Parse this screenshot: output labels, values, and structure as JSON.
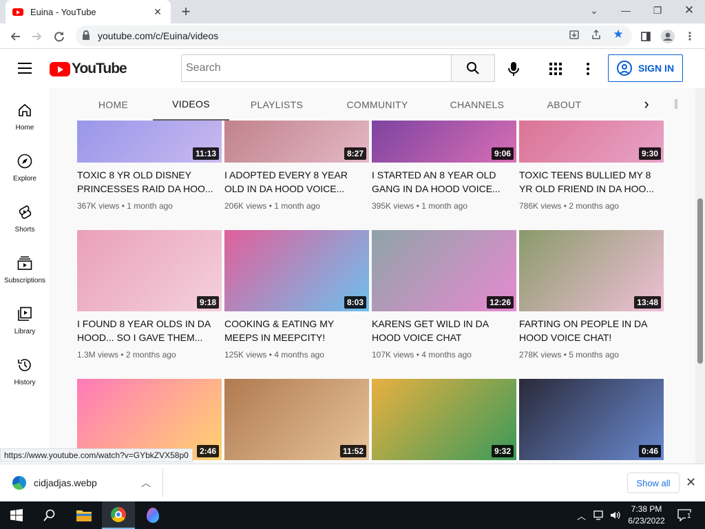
{
  "browser": {
    "tab_title": "Euina - YouTube",
    "url": "youtube.com/c/Euina/videos",
    "status_url": "https://www.youtube.com/watch?v=GYbkZVX58p0"
  },
  "header": {
    "logo_text": "YouTube",
    "search_placeholder": "Search",
    "signin_label": "SIGN IN"
  },
  "channel_tabs": [
    "HOME",
    "VIDEOS",
    "PLAYLISTS",
    "COMMUNITY",
    "CHANNELS",
    "ABOUT"
  ],
  "guide": [
    {
      "label": "Home",
      "icon": "home-icon"
    },
    {
      "label": "Explore",
      "icon": "compass-icon"
    },
    {
      "label": "Shorts",
      "icon": "shorts-icon"
    },
    {
      "label": "Subscriptions",
      "icon": "subscriptions-icon"
    },
    {
      "label": "Library",
      "icon": "library-icon"
    },
    {
      "label": "History",
      "icon": "history-icon"
    }
  ],
  "videos": [
    {
      "title": "TOXIC 8 YR OLD DISNEY PRINCESSES RAID DA HOO...",
      "duration": "11:13",
      "views": "367K views",
      "age": "1 month ago",
      "colors": [
        "#8f8fe8",
        "#c9b9f0"
      ]
    },
    {
      "title": "I ADOPTED EVERY 8 YEAR OLD IN DA HOOD VOICE...",
      "duration": "8:27",
      "views": "206K views",
      "age": "1 month ago",
      "colors": [
        "#b9777f",
        "#e4b8c6"
      ]
    },
    {
      "title": "I STARTED AN 8 YEAR OLD GANG IN DA HOOD VOICE...",
      "duration": "9:06",
      "views": "395K views",
      "age": "1 month ago",
      "colors": [
        "#6a3a9c",
        "#d86fb5"
      ]
    },
    {
      "title": "TOXIC TEENS BULLIED MY 8 YR OLD FRIEND IN DA HOO...",
      "duration": "9:30",
      "views": "786K views",
      "age": "2 months ago",
      "colors": [
        "#d86a8a",
        "#e8a3c8"
      ]
    },
    {
      "title": "I FOUND 8 YEAR OLDS IN DA HOOD... SO I GAVE THEM...",
      "duration": "9:18",
      "views": "1.3M views",
      "age": "2 months ago",
      "colors": [
        "#e9a0b8",
        "#f4d0dc"
      ]
    },
    {
      "title": "COOKING & EATING MY MEEPS IN MEEPCITY!",
      "duration": "8:03",
      "views": "125K views",
      "age": "4 months ago",
      "colors": [
        "#e0609a",
        "#6ec0ee"
      ]
    },
    {
      "title": "KARENS GET WILD IN DA HOOD VOICE CHAT",
      "duration": "12:26",
      "views": "107K views",
      "age": "4 months ago",
      "colors": [
        "#8fa3a8",
        "#e68ad0"
      ]
    },
    {
      "title": "FARTING ON PEOPLE IN DA HOOD VOICE CHAT!",
      "duration": "13:48",
      "views": "278K views",
      "age": "5 months ago",
      "colors": [
        "#8a9a6a",
        "#f0c0d8"
      ]
    },
    {
      "title": "",
      "duration": "2:46",
      "views": "",
      "age": "",
      "colors": [
        "#ff7ab8",
        "#ffd36e"
      ]
    },
    {
      "title": "",
      "duration": "11:52",
      "views": "",
      "age": "",
      "colors": [
        "#b07a50",
        "#e8c49a"
      ]
    },
    {
      "title": "",
      "duration": "9:32",
      "views": "",
      "age": "",
      "colors": [
        "#e8b040",
        "#3a9a5a"
      ]
    },
    {
      "title": "",
      "duration": "0:46",
      "views": "",
      "age": "",
      "colors": [
        "#2a2a3a",
        "#6a8ad0"
      ]
    }
  ],
  "download": {
    "file_name": "cidjadjas.webp",
    "show_all": "Show all"
  },
  "taskbar": {
    "time": "7:38 PM",
    "date": "6/23/2022",
    "notification_count": "1"
  }
}
